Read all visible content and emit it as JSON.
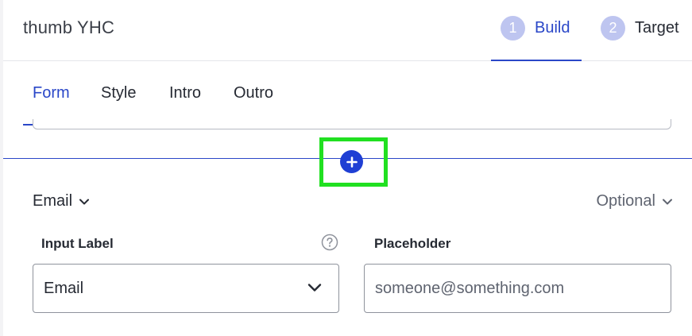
{
  "header": {
    "title": "thumb YHC",
    "steps": [
      {
        "number": "1",
        "label": "Build",
        "active": true
      },
      {
        "number": "2",
        "label": "Target",
        "active": false
      }
    ]
  },
  "tabs": [
    {
      "label": "Form",
      "active": true
    },
    {
      "label": "Style",
      "active": false
    },
    {
      "label": "Intro",
      "active": false
    },
    {
      "label": "Outro",
      "active": false
    }
  ],
  "field": {
    "type": "Email",
    "requirement": "Optional",
    "input_label": {
      "label": "Input Label",
      "value": "Email"
    },
    "placeholder": {
      "label": "Placeholder",
      "value": "someone@something.com"
    }
  },
  "icons": {
    "add": "plus-circle-icon",
    "help": "question-circle-icon",
    "chevron": "chevron-down-icon"
  },
  "colors": {
    "accent": "#2a47c8",
    "add_button": "#1f3fd4",
    "highlight": "#21e021",
    "step_badge": "#bec5f0"
  }
}
